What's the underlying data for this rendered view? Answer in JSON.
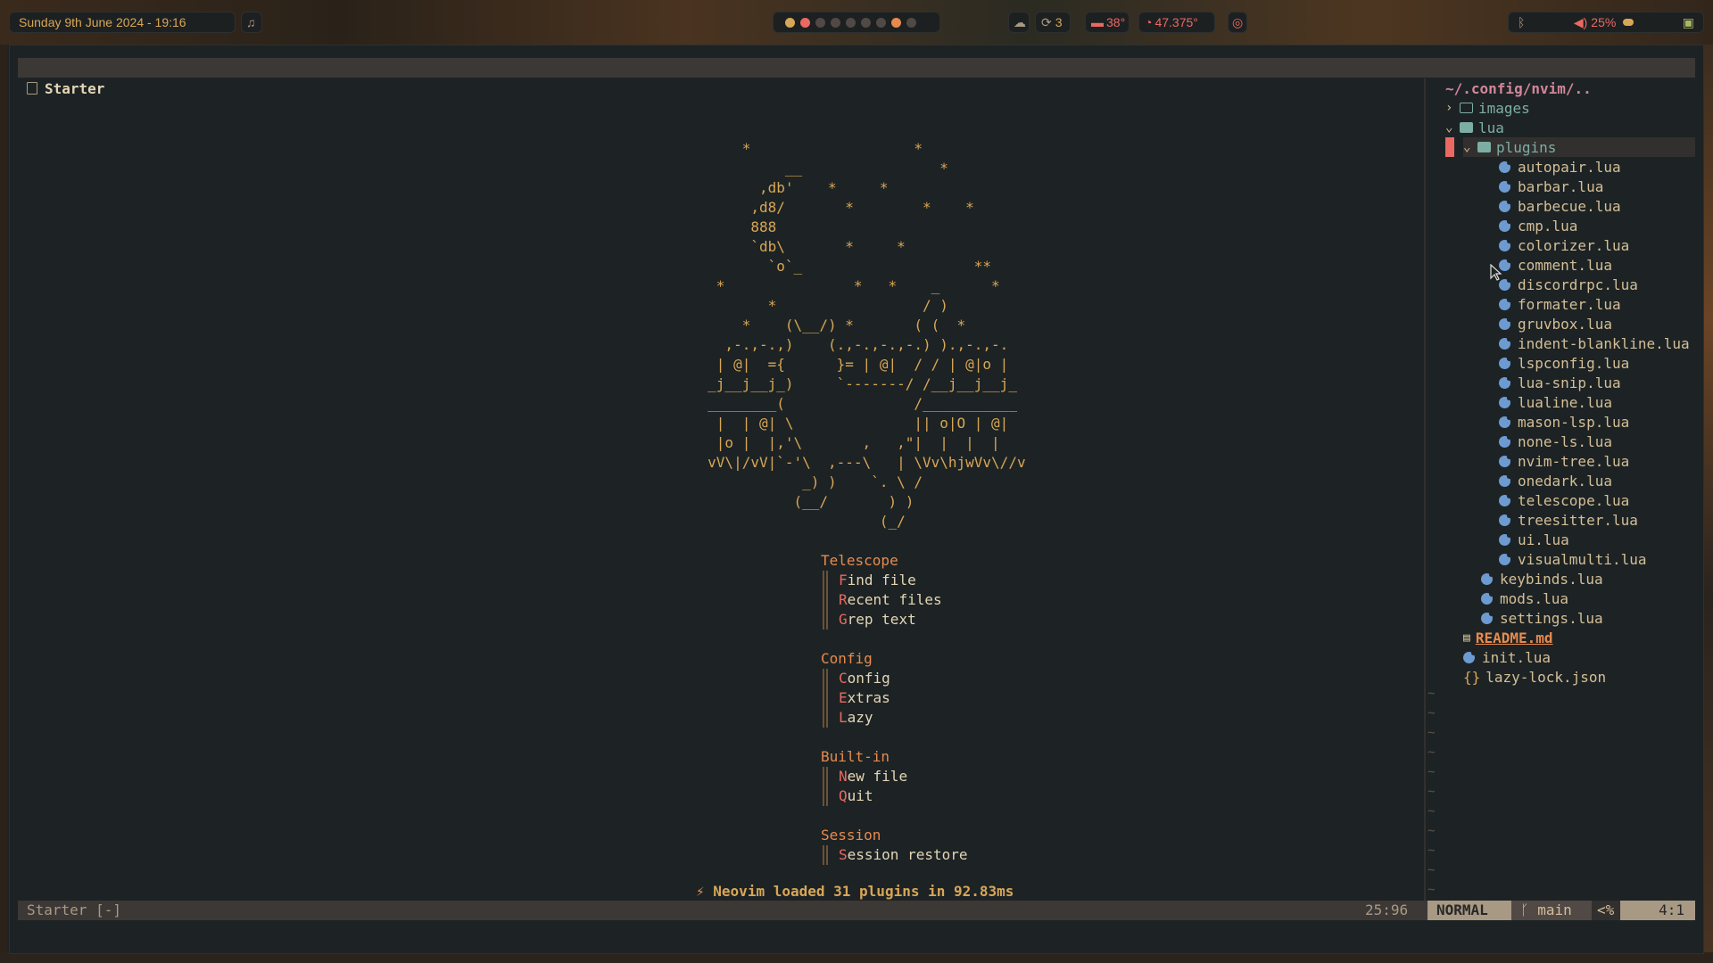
{
  "topbar": {
    "datetime": "Sunday 9th June 2024 - 19:16",
    "music_icon": "music-note-icon",
    "updates": "3",
    "cpu_temp": "38°",
    "gpu_temp": "47.375°",
    "volume": "25%"
  },
  "buffer": {
    "title": "Starter"
  },
  "dashboard": {
    "ascii_art": "         *                   *\n              __                *\n           ,db'    *     *\n          ,d8/       *        *    *\n          888\n          `db\\       *     *\n            `o`_                    **\n      *               *   *    _      *\n            *                 / )\n         *    (\\__/) *       ( (  *\n       ,-.,-.,)    (.,-.,-.,-.) ).,-.,-.\n      | @|  ={      }= | @|  / / | @|o |\n     _j__j__j_)     `-------/ /__j__j__j_\n     ________(               /___________\n      |  | @| \\              || o|O | @|\n      |o |  |,'\\       ,   ,\"|  |  |  |\n     vV\\|/vV|`-'\\  ,---\\   | \\Vv\\hjwVv\\//v\n                _) )    `. \\ /\n               (__/       ) )\n                         (_/",
    "sections": [
      {
        "header": "Telescope",
        "items": [
          {
            "key": "F",
            "rest": "ind file"
          },
          {
            "key": "R",
            "rest": "ecent files"
          },
          {
            "key": "G",
            "rest": "rep text"
          }
        ]
      },
      {
        "header": "Config",
        "items": [
          {
            "key": "C",
            "rest": "onfig"
          },
          {
            "key": "E",
            "rest": "xtras"
          },
          {
            "key": "L",
            "rest": "azy"
          }
        ]
      },
      {
        "header": "Built-in",
        "items": [
          {
            "key": "N",
            "rest": "ew file"
          },
          {
            "key": "Q",
            "rest": "uit"
          }
        ]
      },
      {
        "header": "Session",
        "items": [
          {
            "key": "S",
            "rest": "ession restore"
          }
        ]
      }
    ],
    "loaded_text": "Neovim loaded 31 plugins in 92.83ms"
  },
  "tree": {
    "root": "~/.config/nvim/..",
    "images": "images",
    "lua": "lua",
    "plugins": "plugins",
    "plugin_files": [
      "autopair.lua",
      "barbar.lua",
      "barbecue.lua",
      "cmp.lua",
      "colorizer.lua",
      "comment.lua",
      "discordrpc.lua",
      "formater.lua",
      "gruvbox.lua",
      "indent-blankline.lua",
      "lspconfig.lua",
      "lua-snip.lua",
      "lualine.lua",
      "mason-lsp.lua",
      "none-ls.lua",
      "nvim-tree.lua",
      "onedark.lua",
      "telescope.lua",
      "treesitter.lua",
      "ui.lua",
      "visualmulti.lua"
    ],
    "lua_files": [
      "keybinds.lua",
      "mods.lua",
      "settings.lua"
    ],
    "readme": "README.md",
    "init": "init.lua",
    "lock": "lazy-lock.json"
  },
  "statusline": {
    "left": "Starter [-]",
    "position": "25:96",
    "mode": "NORMAL",
    "branch": "main",
    "percent": "<%",
    "line": "4:1"
  }
}
